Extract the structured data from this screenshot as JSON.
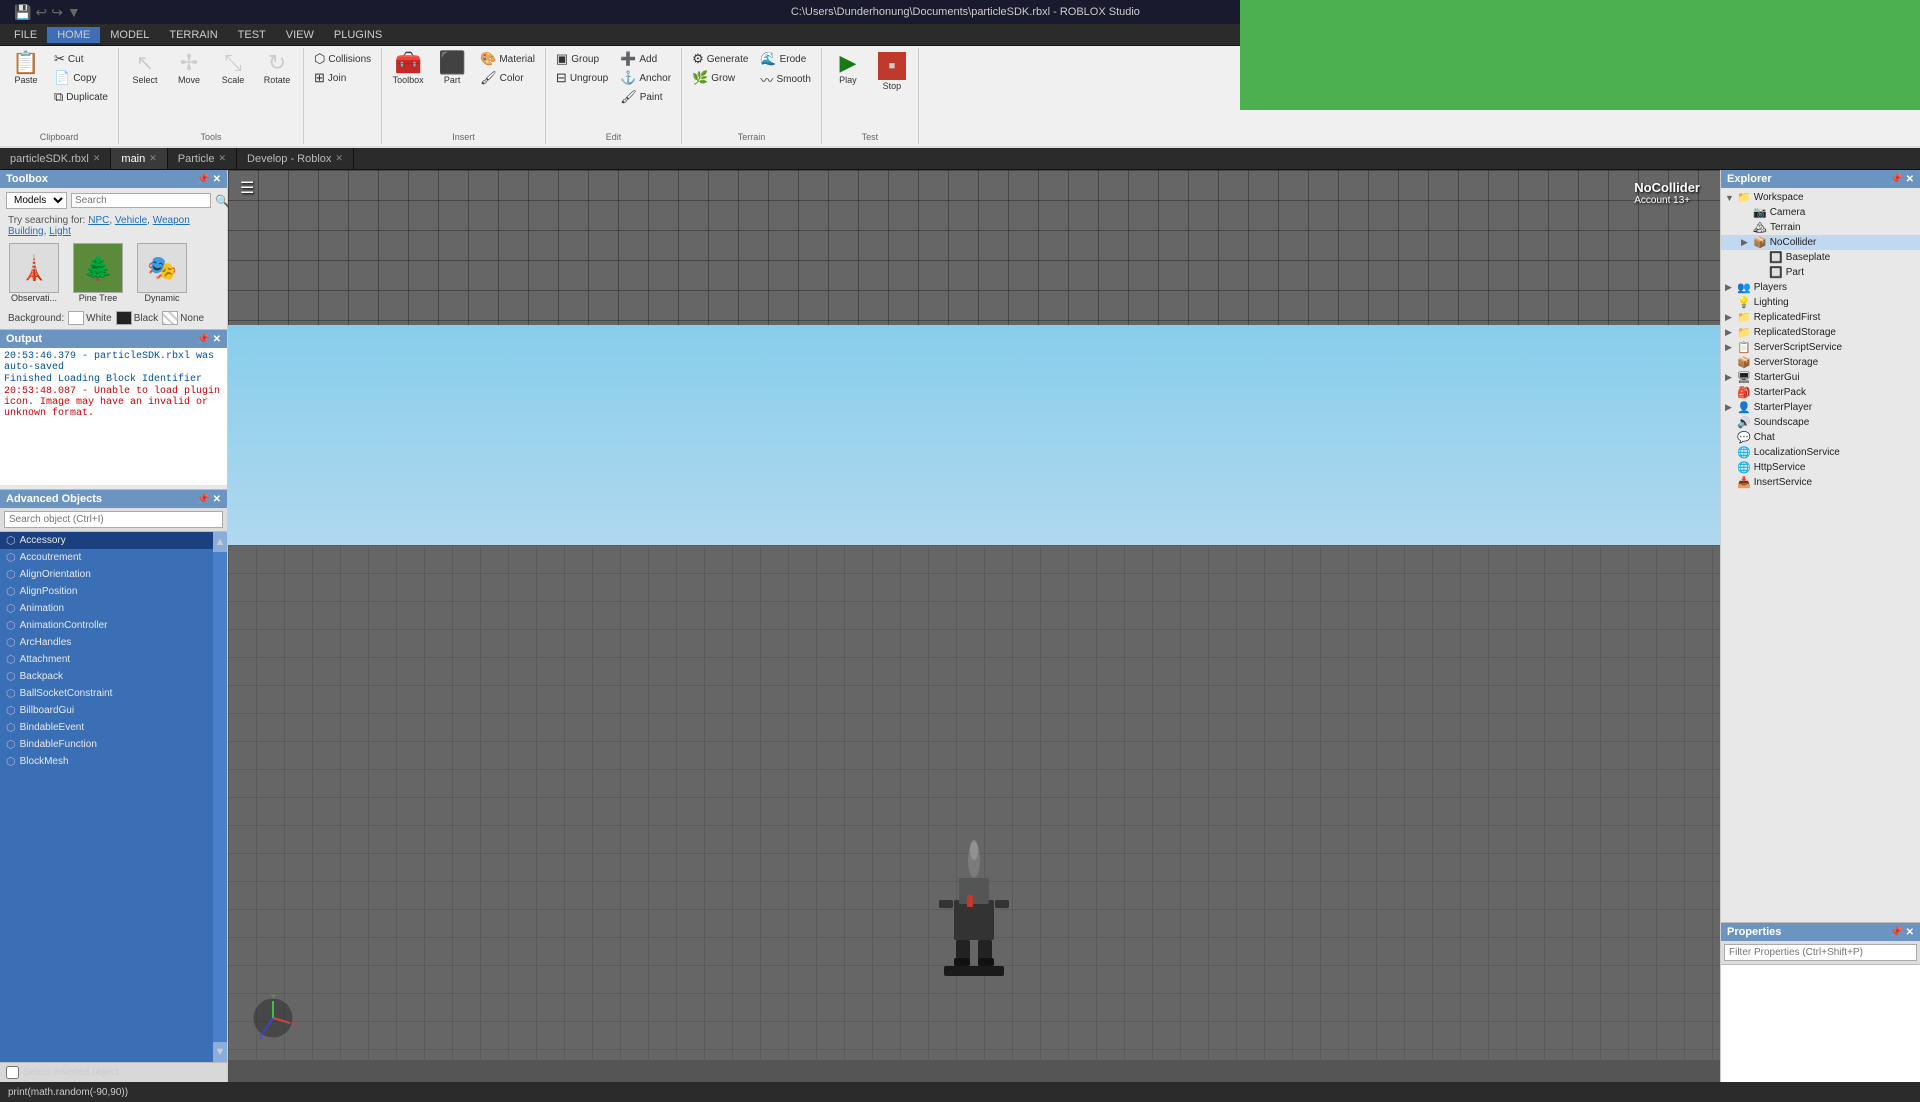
{
  "window": {
    "title": "C:\\Users\\Dunderhonung\\Documents\\particleSDK.rbxl - ROBLOX Studio",
    "controls": [
      "—",
      "□",
      "✕"
    ]
  },
  "menubar": {
    "items": [
      "FILE",
      "HOME",
      "MODEL",
      "TERRAIN",
      "TEST",
      "VIEW",
      "PLUGINS"
    ]
  },
  "ribbon": {
    "active_tab": "HOME",
    "groups": [
      {
        "label": "Clipboard",
        "buttons": [
          "Paste",
          "Cut",
          "Copy",
          "Duplicate"
        ]
      },
      {
        "label": "Tools",
        "buttons": [
          "Select",
          "Move",
          "Scale",
          "Rotate"
        ]
      },
      {
        "label": "Insert",
        "buttons": [
          "Toolbox",
          "Part",
          "Material",
          "Color",
          "Paint",
          "Anchor"
        ]
      },
      {
        "label": "Edit",
        "buttons": [
          "Group",
          "Ungroup",
          "Add",
          "Anchor",
          "Paint"
        ]
      },
      {
        "label": "Terrain",
        "buttons": [
          "Generate",
          "Grow",
          "Erode",
          "Smooth"
        ]
      },
      {
        "label": "Test",
        "buttons": [
          "Play",
          "Stop"
        ]
      }
    ],
    "collisions": "Collisions",
    "join": "Join",
    "smooth": "Smooth"
  },
  "tabs": [
    {
      "id": "particleSDK",
      "label": "particleSDK.rbxl",
      "closable": true
    },
    {
      "id": "main",
      "label": "main",
      "closable": true
    },
    {
      "id": "Particle",
      "label": "Particle",
      "closable": true
    },
    {
      "id": "Develop",
      "label": "Develop - Roblox",
      "closable": true
    }
  ],
  "toolbox": {
    "title": "Toolbox",
    "model_select": "Models",
    "search_placeholder": "Search",
    "suggestions": {
      "prefix": "Try searching for:",
      "items": [
        "NPC",
        "Vehicle",
        "Weapon",
        "Building",
        "Light"
      ]
    },
    "items": [
      {
        "label": "Observati...",
        "icon": "🗼"
      },
      {
        "label": "Pine Tree",
        "icon": "🌲"
      },
      {
        "label": "Dynamic",
        "icon": "🎭"
      }
    ],
    "background_label": "Background:",
    "bg_options": [
      "White",
      "Black",
      "None"
    ]
  },
  "output": {
    "title": "Output",
    "lines": [
      {
        "text": "20:53:46.379 - particleSDK.rbxl was auto-saved",
        "type": "blue"
      },
      {
        "text": "Finished Loading Block Identifier",
        "type": "blue"
      },
      {
        "text": "20:53:48.087 - Unable to load plugin icon. Image may have an invalid or unknown format.",
        "type": "red"
      }
    ]
  },
  "advanced_objects": {
    "title": "Advanced Objects",
    "search_placeholder": "Search object (Ctrl+I)",
    "items": [
      "Accessory",
      "Accoutrement",
      "AlignOrientation",
      "AlignPosition",
      "Animation",
      "AnimationController",
      "ArcHandles",
      "Attachment",
      "Backpack",
      "BallSocketConstraint",
      "BillboardGui",
      "BindableEvent",
      "BindableFunction",
      "BlockMesh"
    ],
    "select_checkbox_label": "Select inserted object",
    "scroll_indicator_top": "▲",
    "scroll_indicator_bottom": "▼"
  },
  "viewport": {
    "nocollider_label": "NoCollider",
    "account_label": "Account 13+"
  },
  "explorer": {
    "title": "Explorer",
    "tree": [
      {
        "label": "Workspace",
        "icon": "📁",
        "depth": 0,
        "expanded": true
      },
      {
        "label": "Camera",
        "icon": "📷",
        "depth": 1
      },
      {
        "label": "Terrain",
        "icon": "🏔",
        "depth": 1
      },
      {
        "label": "NoCollider",
        "icon": "📦",
        "depth": 1,
        "highlighted": true
      },
      {
        "label": "Baseplate",
        "icon": "🔲",
        "depth": 2
      },
      {
        "label": "Part",
        "icon": "🔲",
        "depth": 2
      },
      {
        "label": "Players",
        "icon": "👥",
        "depth": 0
      },
      {
        "label": "Lighting",
        "icon": "💡",
        "depth": 0
      },
      {
        "label": "ReplicatedFirst",
        "icon": "📁",
        "depth": 0
      },
      {
        "label": "ReplicatedStorage",
        "icon": "📁",
        "depth": 0
      },
      {
        "label": "ServerScriptService",
        "icon": "📋",
        "depth": 0
      },
      {
        "label": "ServerStorage",
        "icon": "📦",
        "depth": 0
      },
      {
        "label": "StarterGui",
        "icon": "🖥",
        "depth": 0
      },
      {
        "label": "StarterPack",
        "icon": "🎒",
        "depth": 0
      },
      {
        "label": "StarterPlayer",
        "icon": "👤",
        "depth": 0
      },
      {
        "label": "Soundscape",
        "icon": "🔊",
        "depth": 0
      },
      {
        "label": "Chat",
        "icon": "💬",
        "depth": 0
      },
      {
        "label": "LocalizationService",
        "icon": "🌐",
        "depth": 0
      },
      {
        "label": "HttpService",
        "icon": "🌐",
        "depth": 0
      },
      {
        "label": "InsertService",
        "icon": "📥",
        "depth": 0
      }
    ]
  },
  "properties": {
    "title": "Properties",
    "filter_placeholder": "Filter Properties (Ctrl+Shift+P)"
  },
  "statusbar": {
    "text": "print(math.random(-90,90))"
  },
  "colors": {
    "accent": "#6c94c0",
    "play_green": "#1a7a1a",
    "stop_red": "#c0392b"
  }
}
